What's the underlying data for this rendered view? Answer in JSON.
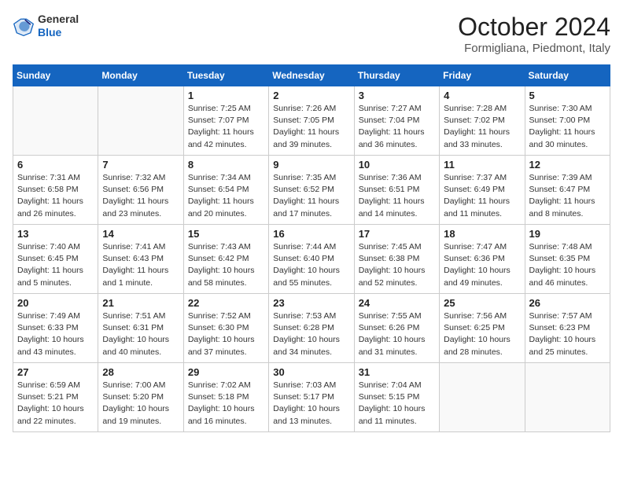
{
  "header": {
    "logo_general": "General",
    "logo_blue": "Blue",
    "month_title": "October 2024",
    "location": "Formigliana, Piedmont, Italy"
  },
  "days_of_week": [
    "Sunday",
    "Monday",
    "Tuesday",
    "Wednesday",
    "Thursday",
    "Friday",
    "Saturday"
  ],
  "weeks": [
    [
      {
        "day": "",
        "info": ""
      },
      {
        "day": "",
        "info": ""
      },
      {
        "day": "1",
        "info": "Sunrise: 7:25 AM\nSunset: 7:07 PM\nDaylight: 11 hours\nand 42 minutes."
      },
      {
        "day": "2",
        "info": "Sunrise: 7:26 AM\nSunset: 7:05 PM\nDaylight: 11 hours\nand 39 minutes."
      },
      {
        "day": "3",
        "info": "Sunrise: 7:27 AM\nSunset: 7:04 PM\nDaylight: 11 hours\nand 36 minutes."
      },
      {
        "day": "4",
        "info": "Sunrise: 7:28 AM\nSunset: 7:02 PM\nDaylight: 11 hours\nand 33 minutes."
      },
      {
        "day": "5",
        "info": "Sunrise: 7:30 AM\nSunset: 7:00 PM\nDaylight: 11 hours\nand 30 minutes."
      }
    ],
    [
      {
        "day": "6",
        "info": "Sunrise: 7:31 AM\nSunset: 6:58 PM\nDaylight: 11 hours\nand 26 minutes."
      },
      {
        "day": "7",
        "info": "Sunrise: 7:32 AM\nSunset: 6:56 PM\nDaylight: 11 hours\nand 23 minutes."
      },
      {
        "day": "8",
        "info": "Sunrise: 7:34 AM\nSunset: 6:54 PM\nDaylight: 11 hours\nand 20 minutes."
      },
      {
        "day": "9",
        "info": "Sunrise: 7:35 AM\nSunset: 6:52 PM\nDaylight: 11 hours\nand 17 minutes."
      },
      {
        "day": "10",
        "info": "Sunrise: 7:36 AM\nSunset: 6:51 PM\nDaylight: 11 hours\nand 14 minutes."
      },
      {
        "day": "11",
        "info": "Sunrise: 7:37 AM\nSunset: 6:49 PM\nDaylight: 11 hours\nand 11 minutes."
      },
      {
        "day": "12",
        "info": "Sunrise: 7:39 AM\nSunset: 6:47 PM\nDaylight: 11 hours\nand 8 minutes."
      }
    ],
    [
      {
        "day": "13",
        "info": "Sunrise: 7:40 AM\nSunset: 6:45 PM\nDaylight: 11 hours\nand 5 minutes."
      },
      {
        "day": "14",
        "info": "Sunrise: 7:41 AM\nSunset: 6:43 PM\nDaylight: 11 hours\nand 1 minute."
      },
      {
        "day": "15",
        "info": "Sunrise: 7:43 AM\nSunset: 6:42 PM\nDaylight: 10 hours\nand 58 minutes."
      },
      {
        "day": "16",
        "info": "Sunrise: 7:44 AM\nSunset: 6:40 PM\nDaylight: 10 hours\nand 55 minutes."
      },
      {
        "day": "17",
        "info": "Sunrise: 7:45 AM\nSunset: 6:38 PM\nDaylight: 10 hours\nand 52 minutes."
      },
      {
        "day": "18",
        "info": "Sunrise: 7:47 AM\nSunset: 6:36 PM\nDaylight: 10 hours\nand 49 minutes."
      },
      {
        "day": "19",
        "info": "Sunrise: 7:48 AM\nSunset: 6:35 PM\nDaylight: 10 hours\nand 46 minutes."
      }
    ],
    [
      {
        "day": "20",
        "info": "Sunrise: 7:49 AM\nSunset: 6:33 PM\nDaylight: 10 hours\nand 43 minutes."
      },
      {
        "day": "21",
        "info": "Sunrise: 7:51 AM\nSunset: 6:31 PM\nDaylight: 10 hours\nand 40 minutes."
      },
      {
        "day": "22",
        "info": "Sunrise: 7:52 AM\nSunset: 6:30 PM\nDaylight: 10 hours\nand 37 minutes."
      },
      {
        "day": "23",
        "info": "Sunrise: 7:53 AM\nSunset: 6:28 PM\nDaylight: 10 hours\nand 34 minutes."
      },
      {
        "day": "24",
        "info": "Sunrise: 7:55 AM\nSunset: 6:26 PM\nDaylight: 10 hours\nand 31 minutes."
      },
      {
        "day": "25",
        "info": "Sunrise: 7:56 AM\nSunset: 6:25 PM\nDaylight: 10 hours\nand 28 minutes."
      },
      {
        "day": "26",
        "info": "Sunrise: 7:57 AM\nSunset: 6:23 PM\nDaylight: 10 hours\nand 25 minutes."
      }
    ],
    [
      {
        "day": "27",
        "info": "Sunrise: 6:59 AM\nSunset: 5:21 PM\nDaylight: 10 hours\nand 22 minutes."
      },
      {
        "day": "28",
        "info": "Sunrise: 7:00 AM\nSunset: 5:20 PM\nDaylight: 10 hours\nand 19 minutes."
      },
      {
        "day": "29",
        "info": "Sunrise: 7:02 AM\nSunset: 5:18 PM\nDaylight: 10 hours\nand 16 minutes."
      },
      {
        "day": "30",
        "info": "Sunrise: 7:03 AM\nSunset: 5:17 PM\nDaylight: 10 hours\nand 13 minutes."
      },
      {
        "day": "31",
        "info": "Sunrise: 7:04 AM\nSunset: 5:15 PM\nDaylight: 10 hours\nand 11 minutes."
      },
      {
        "day": "",
        "info": ""
      },
      {
        "day": "",
        "info": ""
      }
    ]
  ]
}
